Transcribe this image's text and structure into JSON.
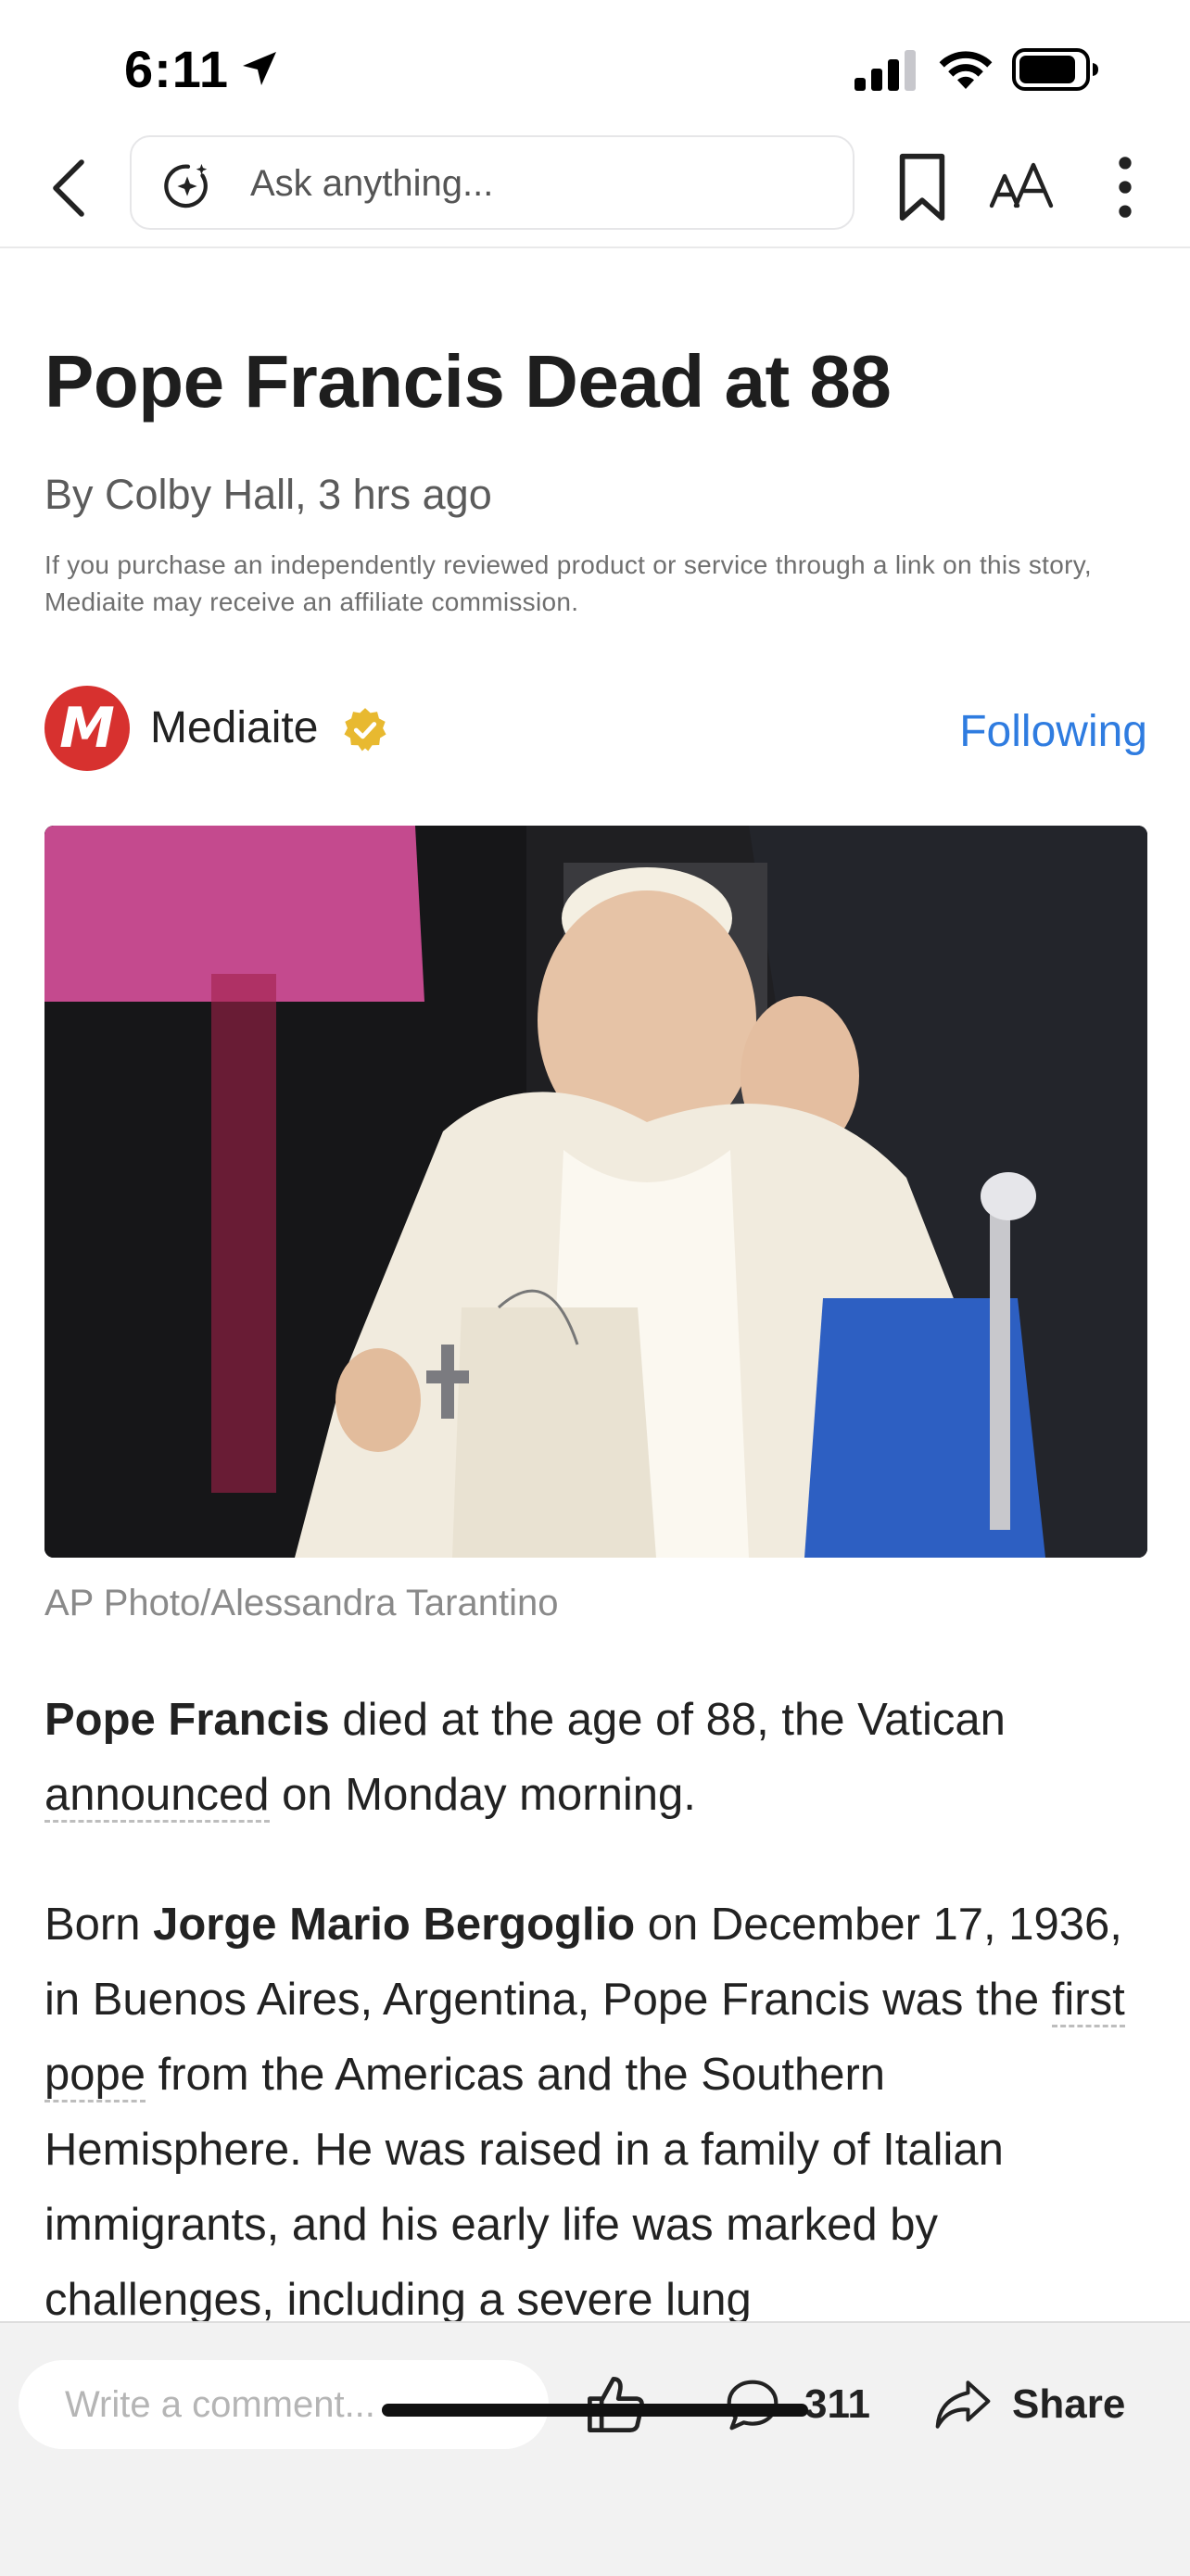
{
  "status_bar": {
    "time": "6:11"
  },
  "search": {
    "placeholder": "Ask anything..."
  },
  "article": {
    "headline": "Pope Francis Dead at 88",
    "byline": "By Colby Hall, 3 hrs ago",
    "disclaimer": "If you purchase an independently reviewed product or service through a link on this story, Mediaite may receive an affiliate commission.",
    "publisher": {
      "name": "Mediaite",
      "logo_letter": "M",
      "follow_label": "Following"
    },
    "image_caption": "AP Photo/Alessandra Tarantino",
    "paragraph1": {
      "bold": "Pope Francis",
      "text_a": " died at the age of 88, the Vatican ",
      "link": "announced",
      "text_b": " on Monday morning."
    },
    "paragraph2": {
      "text_a": "Born ",
      "bold": "Jorge Mario Bergoglio",
      "text_b": " on December 17, 1936, in Buenos Aires, Argentina, Pope Francis was the ",
      "link": "first pope",
      "text_c": " from the Americas and the Southern Hemisphere. He was raised in a family of Italian immigrants, and his early life was marked by challenges, including a severe lung"
    }
  },
  "bottom_bar": {
    "comment_placeholder": "Write a comment...",
    "comment_count": "311",
    "share_label": "Share"
  },
  "colors": {
    "accent": "#2f7ce0",
    "publisher_red": "#d7312f",
    "verified_gold": "#e8b930"
  },
  "icons": [
    "location-arrow-icon",
    "signal-icon",
    "wifi-icon",
    "battery-icon",
    "back-chevron-icon",
    "ai-sparkle-icon",
    "bookmark-icon",
    "text-size-icon",
    "more-vertical-icon",
    "verified-badge-icon",
    "thumbs-up-icon",
    "comment-bubble-icon",
    "share-arrow-icon"
  ]
}
